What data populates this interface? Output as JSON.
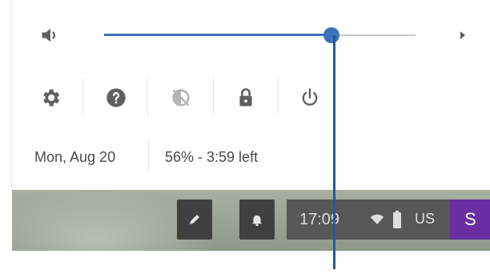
{
  "volume": {
    "level": 0.73,
    "colors": {
      "accent": "#3c72b8",
      "track": "#c7c7c7"
    },
    "icon": "volume-icon",
    "expand_icon": "chevron-right-icon"
  },
  "quick_actions": [
    {
      "name": "settings",
      "icon": "gear-icon"
    },
    {
      "name": "help",
      "icon": "help-icon"
    },
    {
      "name": "night-light",
      "icon": "night-light-off-icon"
    },
    {
      "name": "lock",
      "icon": "lock-icon"
    },
    {
      "name": "power",
      "icon": "power-icon"
    }
  ],
  "status": {
    "date": "Mon, Aug 20",
    "battery": "56% - 3:59 left"
  },
  "shelf": {
    "clock": "17:09",
    "locale": "US",
    "avatar_letter": "S",
    "avatar_color": "#6a2ea3",
    "buttons": [
      {
        "name": "stylus",
        "icon": "pen-icon"
      },
      {
        "name": "notifications",
        "icon": "bell-icon"
      }
    ]
  }
}
